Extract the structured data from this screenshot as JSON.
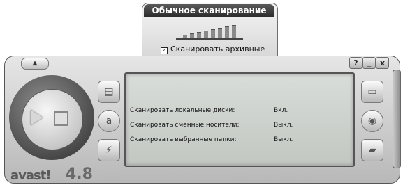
{
  "scan_panel": {
    "title": "Обычное сканирование",
    "level_bars": [
      3,
      5,
      7,
      9,
      11,
      13,
      15,
      17
    ],
    "archive_checkbox": {
      "checked": true,
      "label": "Сканировать архивные"
    }
  },
  "window_buttons": {
    "help": "?",
    "minimize": "_",
    "close": "x"
  },
  "eject_label": "▲",
  "status": {
    "rows": [
      {
        "label": "Сканировать локальные диски:",
        "value": "Вкл."
      },
      {
        "label": "Сканировать сменные носители:",
        "value": "Выкл."
      },
      {
        "label": "Сканировать выбранные папки:",
        "value": "Выкл."
      }
    ]
  },
  "brand": {
    "name": "avast!",
    "version": "4.8"
  },
  "icons": {
    "left": [
      "book-icon",
      "info-icon",
      "lightning-icon"
    ],
    "right": [
      "hard-drive-icon",
      "cd-icon",
      "folder-icon"
    ],
    "play": "play-icon",
    "stop": "stop-icon"
  }
}
